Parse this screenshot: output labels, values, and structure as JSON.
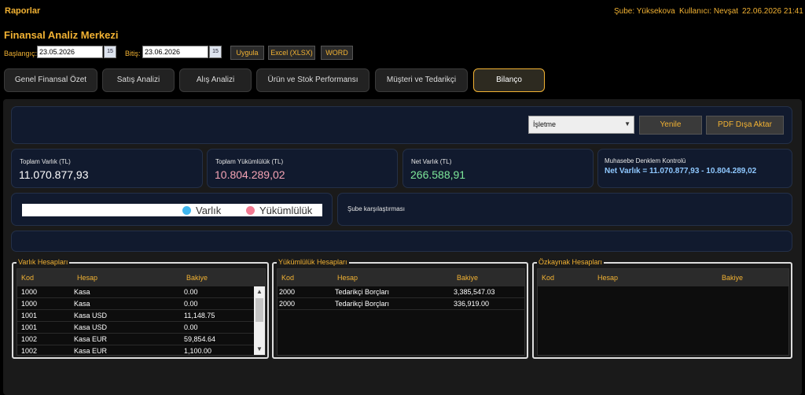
{
  "topbar": {
    "app_title": "Raporlar",
    "branch": "Şube: Yüksekova",
    "user": "Kullanıcı: Nevşat",
    "datetime": "22.06.2026 21:41"
  },
  "page_title": "Finansal Analiz Merkezi",
  "filters": {
    "start_label": "Başlangıç:",
    "start_value": "23.05.2026",
    "end_label": "Bitiş:",
    "end_value": "23.06.2026",
    "calendar_glyph": "15",
    "apply_label": "Uygula",
    "excel_label": "Excel (XLSX)",
    "word_label": "WORD"
  },
  "tabs": [
    {
      "label": "Genel Finansal Özet"
    },
    {
      "label": "Satış Analizi"
    },
    {
      "label": "Alış Analizi"
    },
    {
      "label": "Ürün ve Stok Performansı"
    },
    {
      "label": "Müşteri ve Tedarikçi"
    },
    {
      "label": "Bilanço",
      "active": true
    }
  ],
  "toolbar": {
    "scope_select": "İşletme",
    "refresh_label": "Yenile",
    "pdf_label": "PDF Dışa Aktar"
  },
  "kpis": {
    "total_assets_label": "Toplam Varlık (TL)",
    "total_assets_value": "11.070.877,93",
    "total_liabilities_label": "Toplam Yükümlülük (TL)",
    "total_liabilities_value": "10.804.289,02",
    "net_assets_label": "Net Varlık (TL)",
    "net_assets_value": "266.588,91",
    "equation_label": "Muhasebe Denklem Kontrolü",
    "equation_value": "Net Varlık = 11.070.877,93 - 10.804.289,02"
  },
  "chart_legend": {
    "asset_label": "Varlık",
    "liability_label": "Yükümlülük",
    "branch_compare_label": "Şube karşılaştırması"
  },
  "colors": {
    "accent": "#f2b233",
    "asset_dot": "#3fb6f0",
    "liability_dot": "#f27a92",
    "liability_value": "#f4a3b4",
    "net_value": "#7de89a",
    "equation_value": "#8fc8ff"
  },
  "assets": {
    "title": "Varlık Hesapları",
    "columns": [
      "Kod",
      "Hesap",
      "Bakiye"
    ],
    "rows": [
      [
        "1000",
        "Kasa",
        "0.00"
      ],
      [
        "1000",
        "Kasa",
        "0.00"
      ],
      [
        "1001",
        "Kasa USD",
        "11,148.75"
      ],
      [
        "1001",
        "Kasa USD",
        "0.00"
      ],
      [
        "1002",
        "Kasa EUR",
        "59,854.64"
      ],
      [
        "1002",
        "Kasa EUR",
        "1,100.00"
      ]
    ]
  },
  "liabilities": {
    "title": "Yükümlülük Hesapları",
    "columns": [
      "Kod",
      "Hesap",
      "Bakiye"
    ],
    "rows": [
      [
        "2000",
        "Tedarikçi Borçları",
        "3,385,547.03"
      ],
      [
        "2000",
        "Tedarikçi Borçları",
        "336,919.00"
      ]
    ]
  },
  "equity": {
    "title": "Özkaynak Hesapları",
    "columns": [
      "Kod",
      "Hesap",
      "Bakiye"
    ],
    "rows": []
  }
}
